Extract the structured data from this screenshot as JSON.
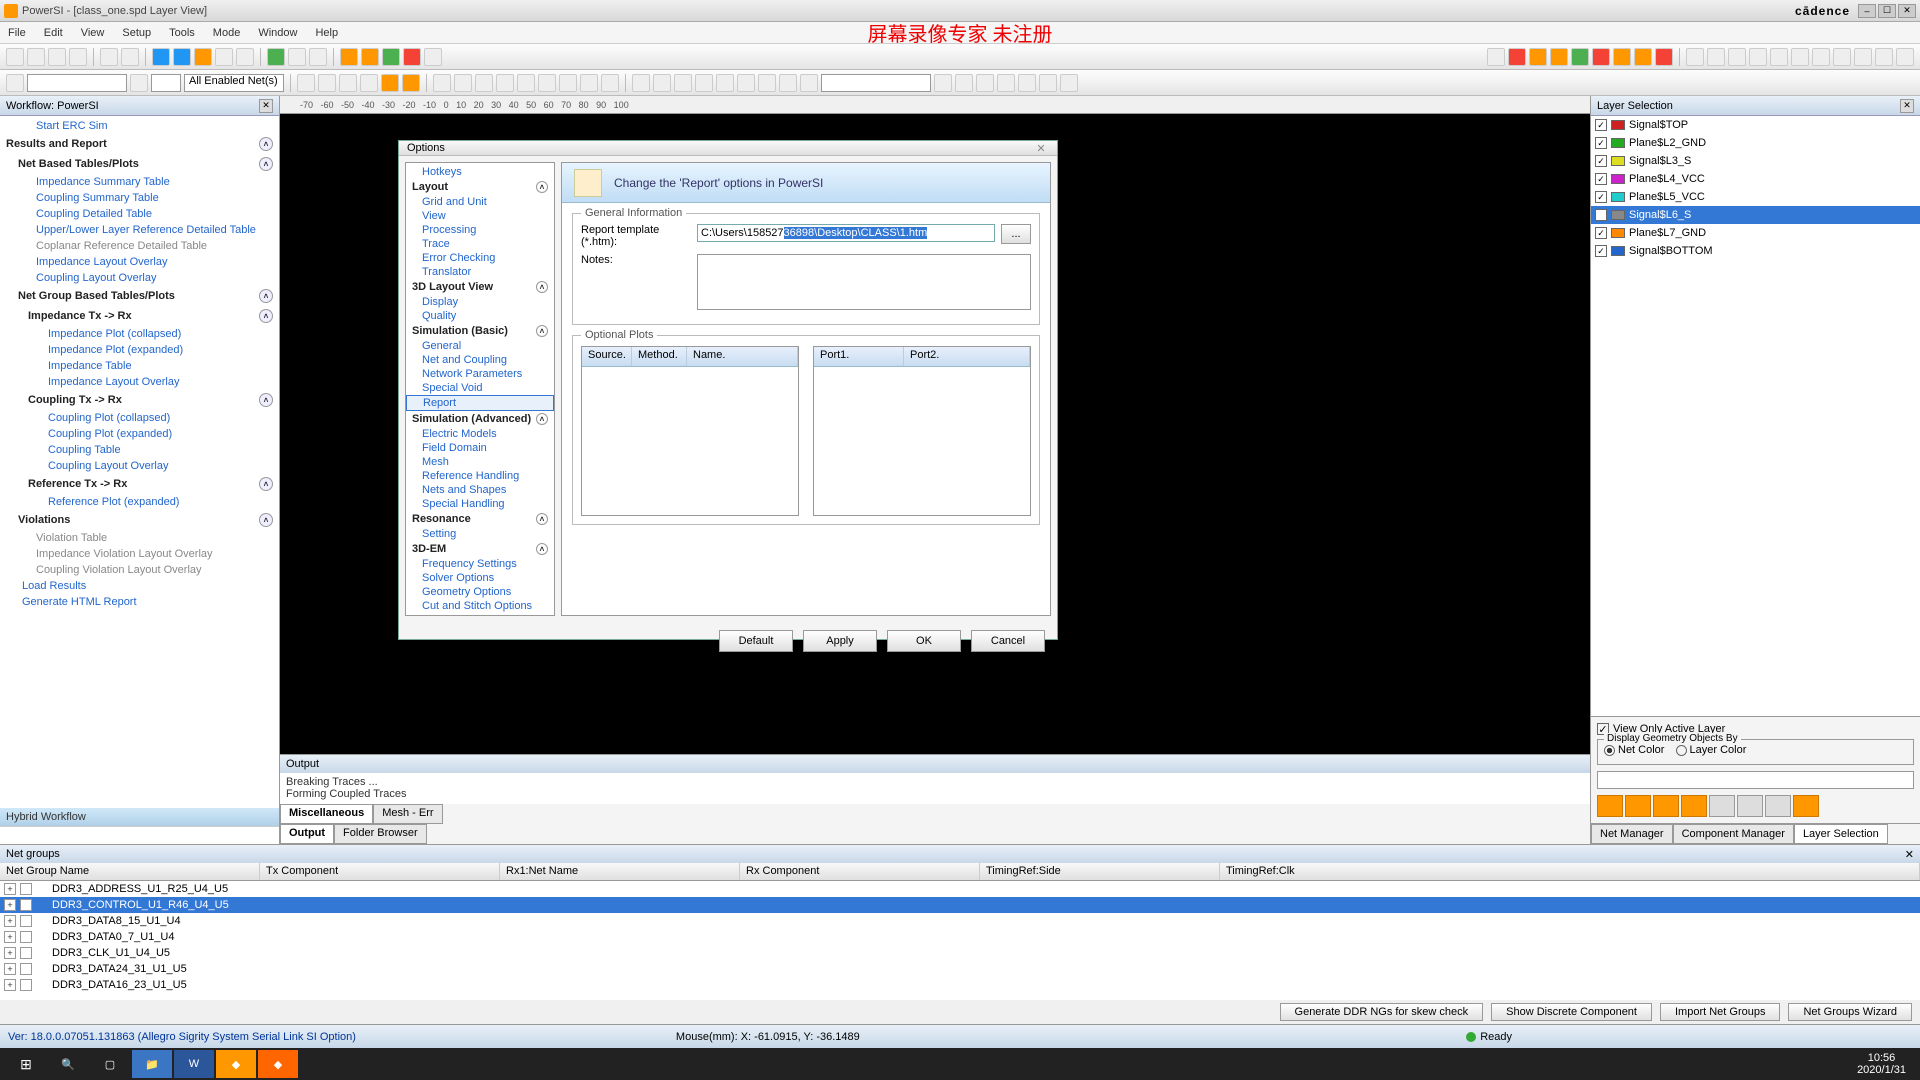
{
  "app": {
    "title": "PowerSI - [class_one.spd Layer View]",
    "brand": "cādence"
  },
  "menu": [
    "File",
    "Edit",
    "View",
    "Setup",
    "Tools",
    "Mode",
    "Window",
    "Help"
  ],
  "watermark": "屏幕录像专家  未注册",
  "toolbar2_select": "All Enabled Net(s)",
  "workflow": {
    "title": "Workflow: PowerSI",
    "items": {
      "start_erc": "Start ERC Sim",
      "results_report": "Results and Report",
      "net_based": "Net Based Tables/Plots",
      "nb": [
        "Impedance Summary Table",
        "Coupling Summary Table",
        "Coupling Detailed Table",
        "Upper/Lower Layer Reference Detailed Table",
        "Coplanar Reference Detailed Table",
        "Impedance Layout Overlay",
        "Coupling Layout Overlay"
      ],
      "net_group": "Net Group Based Tables/Plots",
      "imp_tx": "Impedance Tx -> Rx",
      "imp": [
        "Impedance Plot (collapsed)",
        "Impedance Plot (expanded)",
        "Impedance Table",
        "Impedance Layout Overlay"
      ],
      "cpl_tx": "Coupling Tx -> Rx",
      "cpl": [
        "Coupling Plot (collapsed)",
        "Coupling Plot (expanded)",
        "Coupling Table",
        "Coupling Layout Overlay"
      ],
      "ref_tx": "Reference Tx -> Rx",
      "ref": [
        "Reference Plot (expanded)"
      ],
      "viol_h": "Violations",
      "viol": [
        "Violation Table",
        "Impedance Violation Layout Overlay",
        "Coupling Violation Layout Overlay"
      ],
      "load": "Load Results",
      "gen": "Generate HTML Report",
      "hybrid": "Hybrid Workflow"
    }
  },
  "output": {
    "title": "Output",
    "lines": [
      "Breaking Traces ...",
      "Forming Coupled Traces"
    ],
    "tabs_top": [
      "Miscellaneous",
      "Mesh - Err"
    ],
    "tabs_bot": [
      "Output",
      "Folder Browser"
    ]
  },
  "layers": {
    "title": "Layer Selection",
    "rows": [
      {
        "name": "Signal$TOP",
        "color": "#cc2222"
      },
      {
        "name": "Plane$L2_GND",
        "color": "#22aa22"
      },
      {
        "name": "Signal$L3_S",
        "color": "#dddd22"
      },
      {
        "name": "Plane$L4_VCC",
        "color": "#cc22cc"
      },
      {
        "name": "Plane$L5_VCC",
        "color": "#22cccc"
      },
      {
        "name": "Signal$L6_S",
        "color": "#888888",
        "sel": true
      },
      {
        "name": "Plane$L7_GND",
        "color": "#ff8800"
      },
      {
        "name": "Signal$BOTTOM",
        "color": "#2266cc"
      }
    ],
    "view_active": "View Only Active Layer",
    "disp_geom": "Display Geometry Objects By",
    "net_color": "Net Color",
    "layer_color": "Layer Color",
    "tabs": [
      "Net Manager",
      "Component Manager",
      "Layer Selection"
    ]
  },
  "netgroups": {
    "title": "Net groups",
    "cols": [
      "Net Group Name",
      "Tx Component",
      "Rx1:Net Name",
      "Rx Component",
      "TimingRef:Side",
      "TimingRef:Clk"
    ],
    "rows": [
      "DDR3_ADDRESS_U1_R25_U4_U5",
      "DDR3_CONTROL_U1_R46_U4_U5",
      "DDR3_DATA8_15_U1_U4",
      "DDR3_DATA0_7_U1_U4",
      "DDR3_CLK_U1_U4_U5",
      "DDR3_DATA24_31_U1_U5",
      "DDR3_DATA16_23_U1_U5"
    ],
    "sel_idx": 1,
    "btns": [
      "Generate DDR NGs for skew check",
      "Show Discrete Component",
      "Import Net Groups",
      "Net Groups Wizard"
    ]
  },
  "status": {
    "version": "Ver: 18.0.0.07051.131863   (Allegro Sigrity System Serial Link SI Option)",
    "mouse": "Mouse(mm): X: -61.0915, Y: -36.1489",
    "ready": "Ready"
  },
  "clock": {
    "time": "10:56",
    "date": "2020/1/31"
  },
  "dialog": {
    "title": "Options",
    "tree": {
      "hotkeys": "Hotkeys",
      "layout": "Layout",
      "layout_items": [
        "Grid and Unit",
        "View",
        "Processing",
        "Trace",
        "Error Checking",
        "Translator"
      ],
      "view3d": "3D Layout View",
      "view3d_items": [
        "Display",
        "Quality"
      ],
      "simb": "Simulation (Basic)",
      "simb_items": [
        "General",
        "Net and Coupling",
        "Network Parameters",
        "Special Void",
        "Report"
      ],
      "sima": "Simulation (Advanced)",
      "sima_items": [
        "Electric Models",
        "Field Domain",
        "Mesh",
        "Reference Handling",
        "Nets and Shapes",
        "Special Handling"
      ],
      "res": "Resonance",
      "res_items": [
        "Setting"
      ],
      "em": "3D-EM",
      "em_items": [
        "Frequency Settings",
        "Solver Options",
        "Geometry Options",
        "Cut and Stitch Options"
      ]
    },
    "banner": "Change the 'Report' options in PowerSI",
    "general_info": "General Information",
    "report_tpl_label": "Report template (*.htm):",
    "report_tpl_pre": "C:\\Users\\158527",
    "report_tpl_sel": "36898\\Desktop\\CLASS\\1.htm",
    "browse": "...",
    "notes_label": "Notes:",
    "optional_plots": "Optional Plots",
    "tbl1": [
      "Source.",
      "Method.",
      "Name."
    ],
    "tbl2": [
      "Port1.",
      "Port2."
    ],
    "btns": [
      "Default",
      "Apply",
      "OK",
      "Cancel"
    ]
  }
}
